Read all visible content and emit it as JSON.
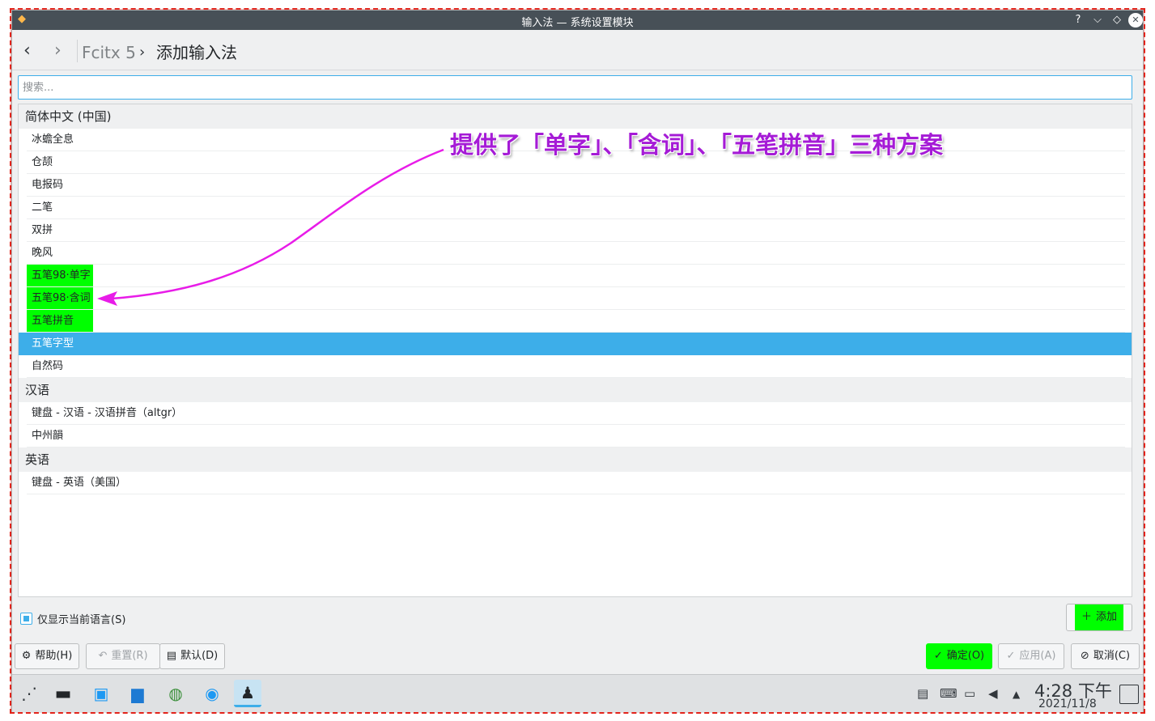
{
  "window": {
    "title": "输入法 — 系统设置模块",
    "help_glyph": "?",
    "minimize_glyph": "⌵",
    "maximize_glyph": "◇",
    "close_glyph": "✕"
  },
  "nav": {
    "back_glyph": "‹",
    "forward_glyph": "›",
    "breadcrumb_parent": "Fcitx 5",
    "breadcrumb_sep": "›",
    "breadcrumb_current": "添加输入法"
  },
  "search": {
    "placeholder": "搜索...",
    "value": ""
  },
  "groups": [
    {
      "header": "简体中文 (中国)",
      "items": [
        "冰蟾全息",
        "仓颉",
        "电报码",
        "二笔",
        "双拼",
        "晚风",
        "五笔98·单字",
        "五笔98·含词",
        "五笔拼音",
        "五笔字型",
        "自然码"
      ]
    },
    {
      "header": "汉语",
      "items": [
        "键盘 - 汉语 - 汉语拼音（altgr）",
        "中州韻"
      ]
    },
    {
      "header": "英语",
      "items": [
        "键盘 - 英语（美国）"
      ]
    }
  ],
  "highlighted_items": [
    "五笔98·单字",
    "五笔98·含词",
    "五笔拼音"
  ],
  "selected_item": "五笔字型",
  "annotation": {
    "text": "提供了「单字」、「含词」、「五笔拼音」三种方案",
    "color": "#a51bd6"
  },
  "only_current_language": {
    "label": "仅显示当前语言(S)",
    "checked": true
  },
  "buttons": {
    "add": "添加",
    "help": "帮助(H)",
    "reset": "重置(R)",
    "defaults": "默认(D)",
    "ok": "确定(O)",
    "apply": "应用(A)",
    "cancel": "取消(C)"
  },
  "taskbar": {
    "time": "4:28 下午",
    "date": "2021/11/8",
    "apps": [
      "launcher-icon",
      "system-monitor-icon",
      "software-store-icon",
      "file-manager-icon",
      "network-globe-icon",
      "browser-icon",
      "penguin-icon"
    ]
  },
  "colors": {
    "accent": "#3daee9",
    "highlight_green": "#00ff00",
    "annotation_arrow": "#e81ce8"
  }
}
